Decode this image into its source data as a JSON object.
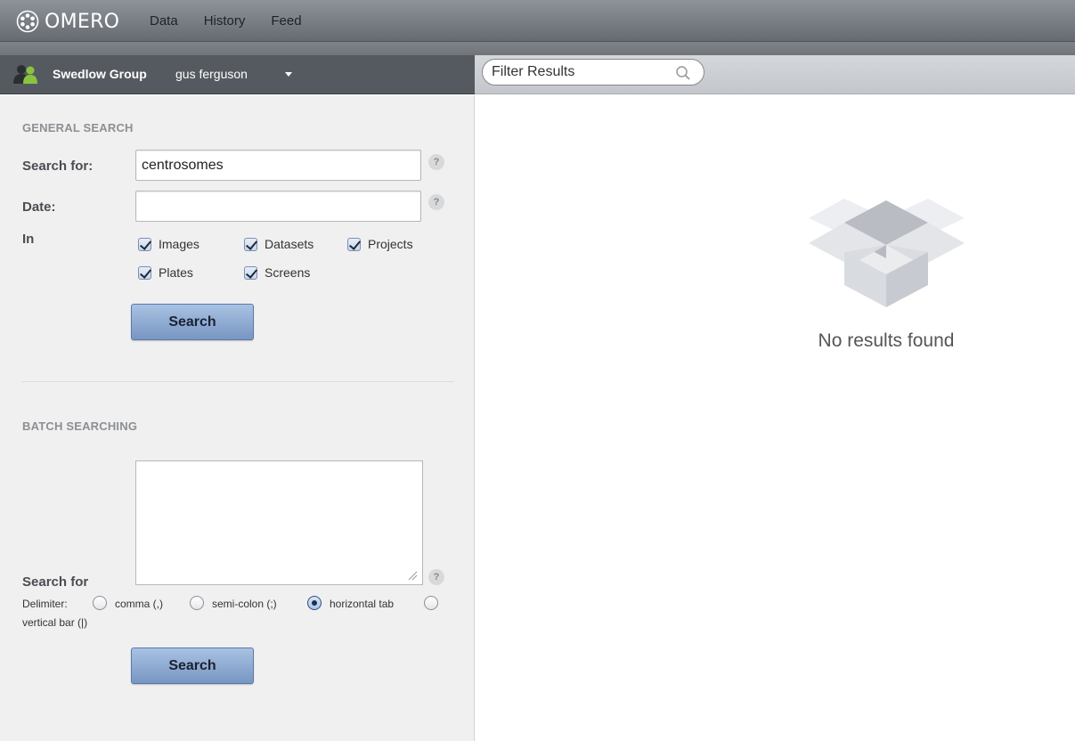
{
  "app": {
    "name": "OMERO"
  },
  "nav": {
    "items": [
      "Data",
      "History",
      "Feed"
    ]
  },
  "user_bar": {
    "group": "Swedlow Group",
    "user": "gus ferguson"
  },
  "filter": {
    "placeholder": "Filter Results"
  },
  "general_search": {
    "title": "GENERAL SEARCH",
    "search_for_label": "Search for:",
    "search_for_value": "centrosomes",
    "date_label": "Date:",
    "date_value": "",
    "in_label": "In",
    "scopes": [
      {
        "label": "Images",
        "checked": true
      },
      {
        "label": "Datasets",
        "checked": true
      },
      {
        "label": "Projects",
        "checked": true
      },
      {
        "label": "Plates",
        "checked": true
      },
      {
        "label": "Screens",
        "checked": true
      }
    ],
    "help_label": "?",
    "search_button": "Search"
  },
  "batch_search": {
    "title": "BATCH SEARCHING",
    "search_for_label": "Search for",
    "textarea_value": "",
    "delimiter_label": "Delimiter:",
    "delimiters": [
      {
        "label": "comma (,)",
        "selected": false
      },
      {
        "label": "semi-colon (;)",
        "selected": false
      },
      {
        "label": "horizontal tab",
        "selected": true
      },
      {
        "label": "vertical bar (|)",
        "selected": false
      }
    ],
    "help_label": "?",
    "search_button": "Search"
  },
  "results": {
    "empty_message": "No results found"
  },
  "colors": {
    "accent_button": "#8aa8d2",
    "topbar": "#7a7f86",
    "user_bar": "#555a60",
    "panel_bg": "#f0f0f1"
  }
}
